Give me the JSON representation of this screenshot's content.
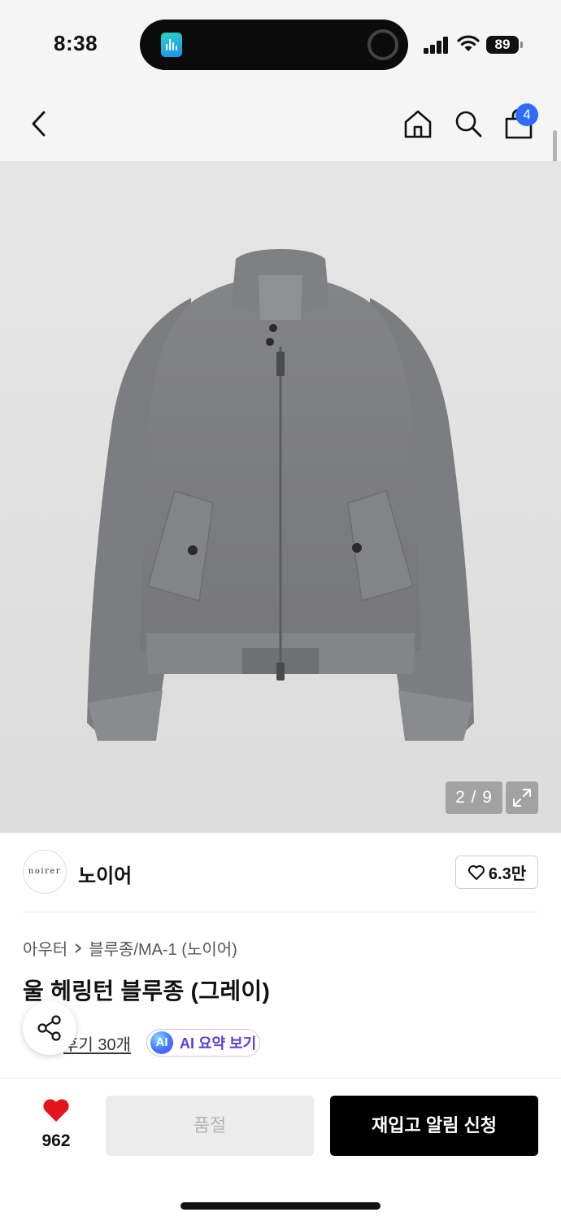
{
  "status_bar": {
    "time": "8:38",
    "battery": "89"
  },
  "nav": {
    "cart_count": "4"
  },
  "gallery": {
    "counter": "2 / 9"
  },
  "brand": {
    "logo_text": "noirer",
    "name": "노이어",
    "likes": "6.3만"
  },
  "product": {
    "breadcrumb": [
      "아우터",
      "블루종/MA-1 (노이어)"
    ],
    "title": "울 헤링턴 블루종 (그레이)",
    "review_text": "후기 30개",
    "ai_badge": "AI",
    "ai_summary_label": "AI 요약 보기"
  },
  "bottom_bar": {
    "wish_count": "962",
    "soldout_label": "품절",
    "restock_label": "재입고 알림 신청"
  },
  "colors": {
    "accent_blue": "#2f6cf6",
    "heart_red": "#e4141c",
    "ai_purple": "#5a3fd6"
  }
}
